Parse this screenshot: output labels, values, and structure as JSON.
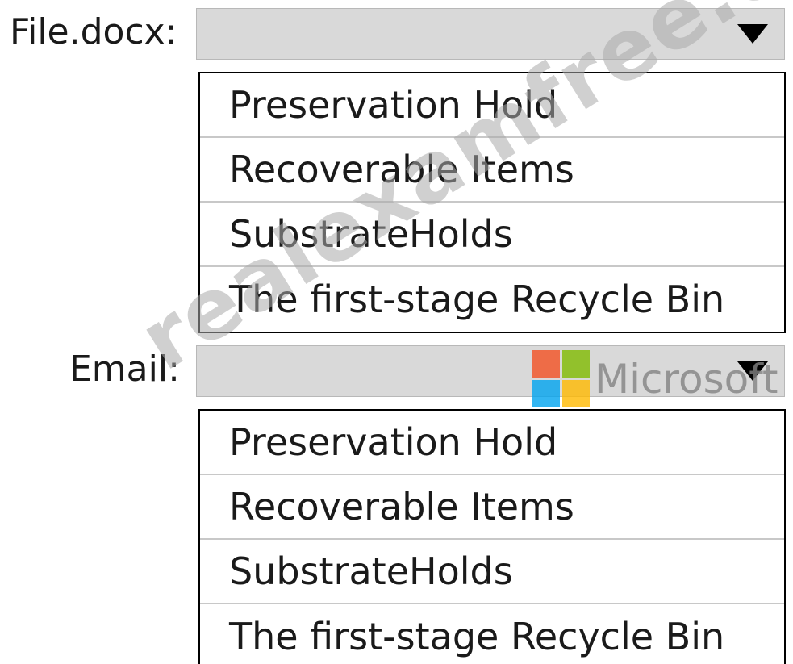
{
  "fields": [
    {
      "label": "File.docx:",
      "selected_value": "",
      "options": [
        "Preservation Hold",
        "Recoverable Items",
        "SubstrateHolds",
        "The first-stage Recycle Bin"
      ]
    },
    {
      "label": "Email:",
      "selected_value": "",
      "options": [
        "Preservation Hold",
        "Recoverable Items",
        "SubstrateHolds",
        "The first-stage Recycle Bin"
      ]
    }
  ],
  "watermark": {
    "text": "realexamfree.com"
  },
  "logo": {
    "text": "Microsoft",
    "colors": [
      "#f25022",
      "#7fba00",
      "#00a4ef",
      "#ffb900"
    ]
  },
  "icons": {
    "dropdown_arrow": "triangle-down-icon"
  }
}
